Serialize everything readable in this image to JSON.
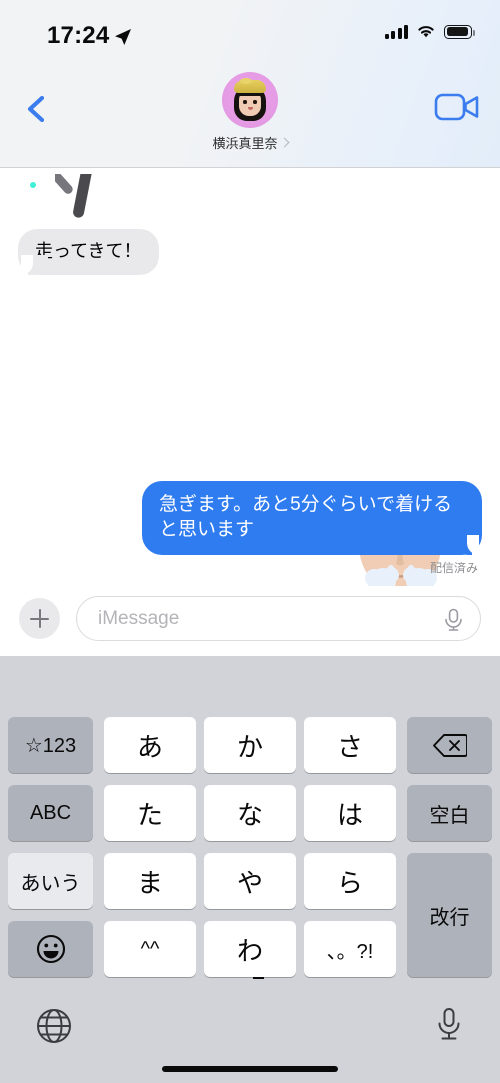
{
  "status_bar": {
    "time": "17:24",
    "location_icon": "location-arrow-icon",
    "signal_icon": "cellular-signal-icon",
    "wifi_icon": "wifi-icon",
    "battery_icon": "battery-full-icon"
  },
  "nav_bar": {
    "back_icon": "chevron-left-icon",
    "video_icon": "facetime-video-camera-icon",
    "contact_name": "横浜真里奈",
    "contact_chevron_icon": "chevron-right-icon",
    "avatar_icon": "memoji-avatar"
  },
  "conversation": {
    "messages": [
      {
        "id": "sticker-partial",
        "type": "sticker",
        "direction": "incoming",
        "description": "partially-scrolled-sticker"
      },
      {
        "id": "msg-in-1",
        "type": "text",
        "direction": "incoming",
        "text": "走ってきて！"
      },
      {
        "id": "msg-out-memoji",
        "type": "sticker",
        "direction": "outgoing",
        "description": "memoji-steam-from-nose"
      },
      {
        "id": "msg-out-1",
        "type": "text",
        "direction": "outgoing",
        "text": "急ぎます。あと5分ぐらいで着けると思います",
        "receipt": "配信済み"
      }
    ]
  },
  "input_bar": {
    "plus_icon": "plus-icon",
    "placeholder": "iMessage",
    "value": "",
    "mic_icon": "microphone-icon"
  },
  "keyboard": {
    "layout": "japanese-kana-12-key",
    "keys": {
      "numbers": "☆123",
      "abc": "ABC",
      "kana": "あいう",
      "emoji": "emoji-smiley-icon",
      "delete": "delete-backspace-icon",
      "space": "空白",
      "return": "改行",
      "row1": [
        "あ",
        "か",
        "さ"
      ],
      "row2": [
        "た",
        "な",
        "は"
      ],
      "row3": [
        "ま",
        "や",
        "ら"
      ],
      "row4": [
        "^^",
        "わ",
        "、。?!"
      ]
    },
    "bottom": {
      "globe_icon": "globe-language-icon",
      "dictation_icon": "microphone-dictation-icon",
      "home_indicator": "home-indicator"
    }
  },
  "colors": {
    "outgoing_bubble": "#2f7cf0",
    "incoming_bubble": "#e9e9eb",
    "accent_blue": "#3b7cef",
    "keyboard_bg": "#d1d3d9",
    "key_gray": "#aeb2bb",
    "avatar_bg": "#e09ce0"
  }
}
